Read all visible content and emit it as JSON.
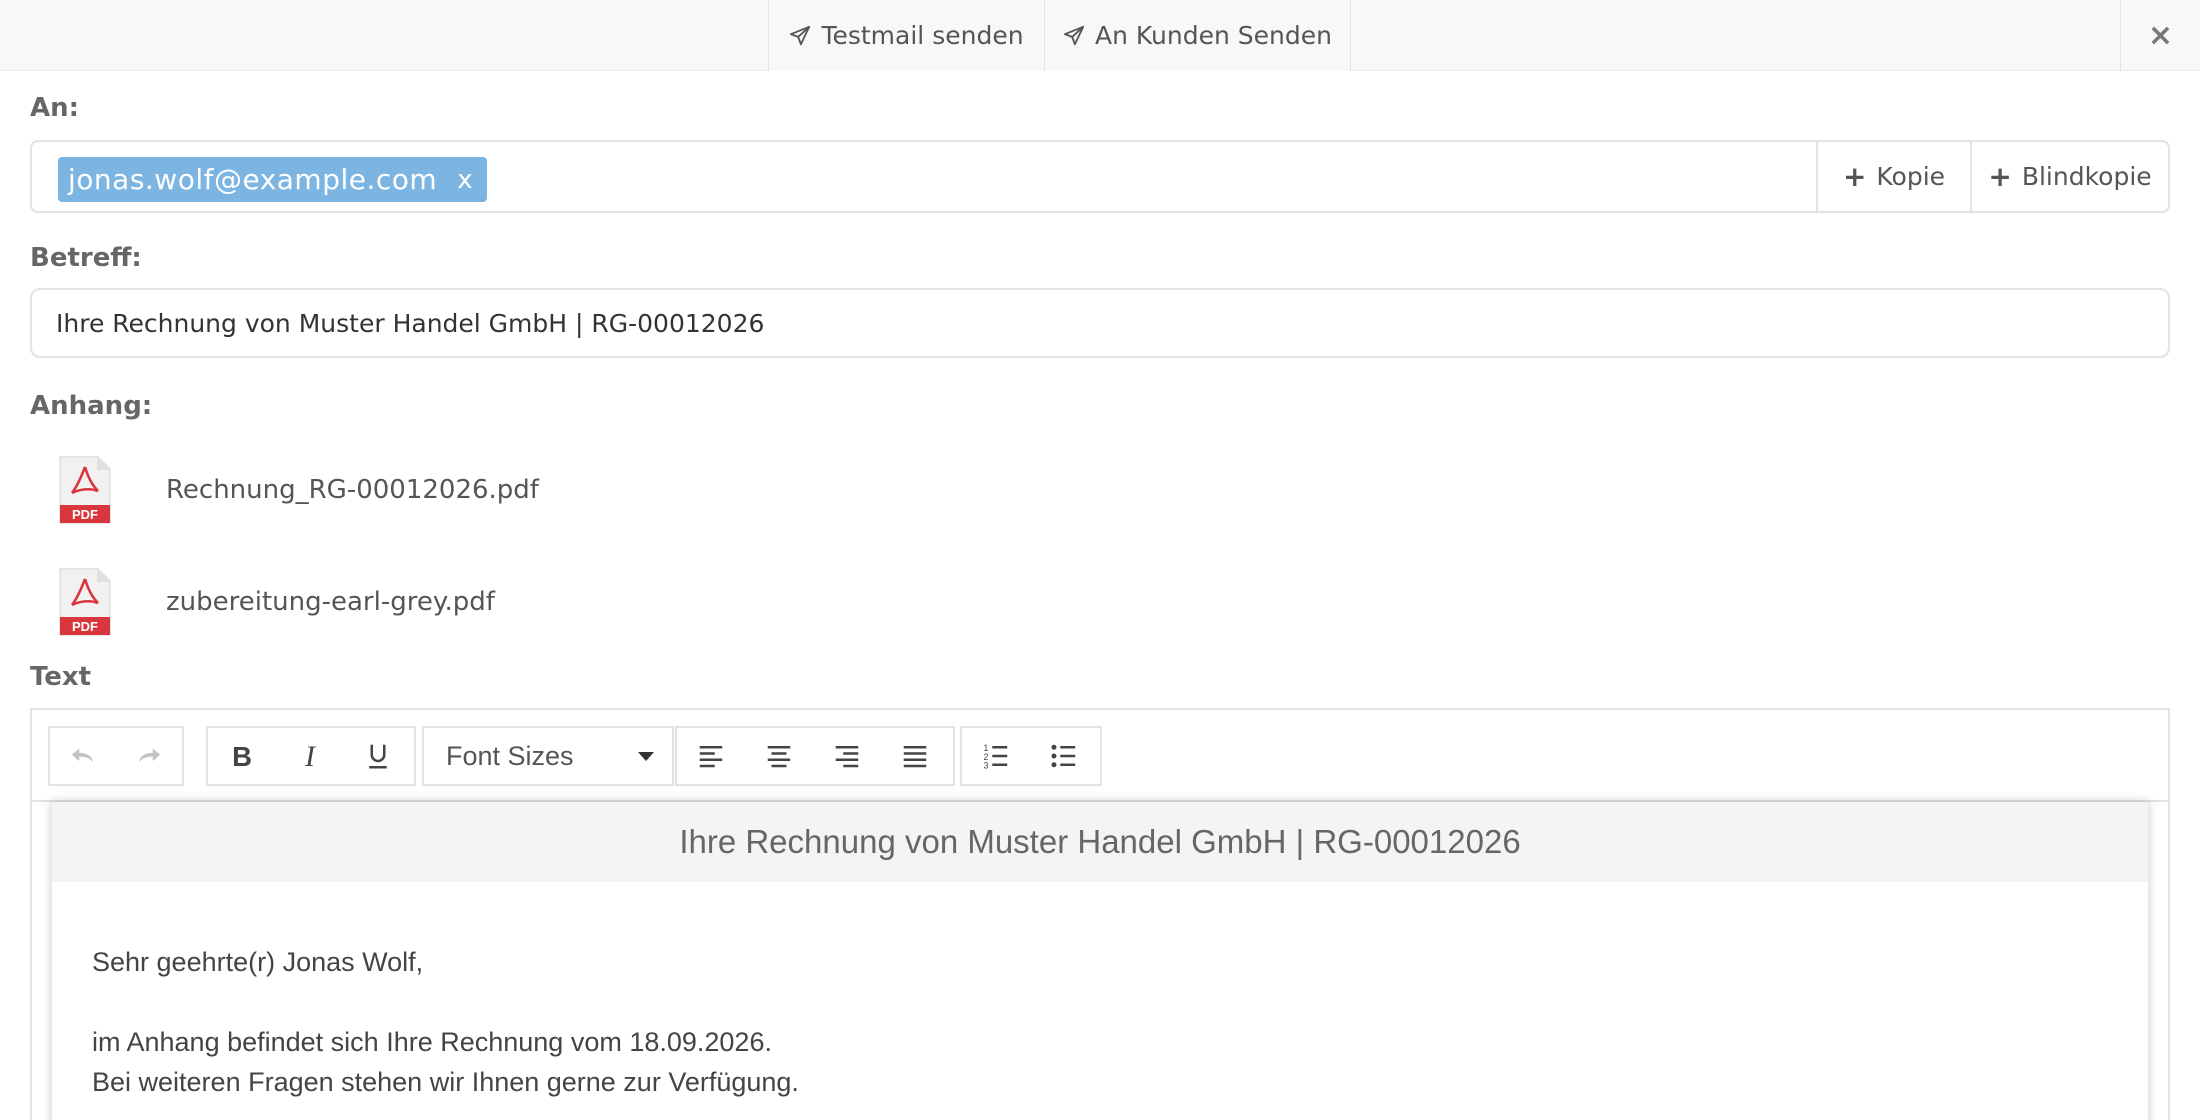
{
  "toolbar": {
    "testmail_label": "Testmail senden",
    "send_customer_label": "An Kunden Senden",
    "close_label": "×"
  },
  "to": {
    "label": "An:",
    "recipient": "jonas.wolf@example.com",
    "remove_label": "x",
    "cc_label": "Kopie",
    "bcc_label": "Blindkopie"
  },
  "subject": {
    "label": "Betreff:",
    "value": "Ihre Rechnung von Muster Handel GmbH | RG-00012026"
  },
  "attachments": {
    "label": "Anhang:",
    "files": [
      {
        "name": "Rechnung_RG-00012026.pdf",
        "icon": "pdf-icon"
      },
      {
        "name": "zubereitung-earl-grey.pdf",
        "icon": "pdf-icon"
      }
    ]
  },
  "text": {
    "label": "Text",
    "font_sizes_label": "Font Sizes",
    "doc_title": "Ihre Rechnung von Muster Handel GmbH | RG-00012026",
    "greeting": "Sehr geehrte(r) Jonas Wolf,",
    "line1": "im Anhang befindet sich Ihre Rechnung vom 18.09.2026.",
    "line2": "Bei weiteren Fragen stehen wir Ihnen gerne zur Verfügung."
  },
  "colors": {
    "chip": "#7cb4e2",
    "pdf_red": "#d9373d"
  }
}
